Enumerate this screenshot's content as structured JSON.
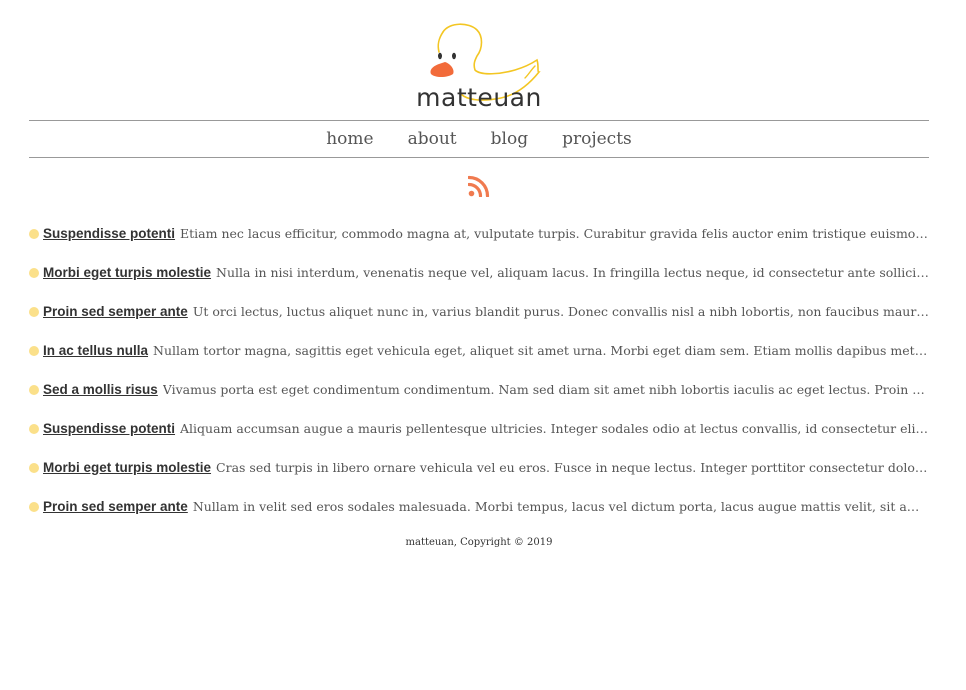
{
  "site": {
    "brand": "matteuan"
  },
  "nav": {
    "items": [
      "home",
      "about",
      "blog",
      "projects"
    ]
  },
  "feed": {
    "icon": "rss-icon",
    "accent": "#f07a4f"
  },
  "posts": [
    {
      "title": "Suspendisse potenti",
      "excerpt": "Etiam nec lacus efficitur, commodo magna at, vulputate turpis. Curabitur gravida felis auctor enim tristique euismod. Pelle..."
    },
    {
      "title": "Morbi eget turpis molestie",
      "excerpt": "Nulla in nisi interdum, venenatis neque vel, aliquam lacus. In fringilla lectus neque, id consectetur ante sollicitudin ..."
    },
    {
      "title": "Proin sed semper ante",
      "excerpt": "Ut orci lectus, luctus aliquet nunc in, varius blandit purus. Donec convallis nisl a nibh lobortis, non faucibus mauris ultri..."
    },
    {
      "title": "In ac tellus nulla",
      "excerpt": "Nullam tortor magna, sagittis eget vehicula eget, aliquet sit amet urna. Morbi eget diam sem. Etiam mollis dapibus metus non..."
    },
    {
      "title": "Sed a mollis risus",
      "excerpt": "Vivamus porta est eget condimentum condimentum. Nam sed diam sit amet nibh lobortis iaculis ac eget lectus. Proin facilis..."
    },
    {
      "title": "Suspendisse potenti",
      "excerpt": "Aliquam accumsan augue a mauris pellentesque ultricies. Integer sodales odio at lectus convallis, id consectetur elit pelle..."
    },
    {
      "title": "Morbi eget turpis molestie",
      "excerpt": "Cras sed turpis in libero ornare vehicula vel eu eros. Fusce in neque lectus. Integer porttitor consectetur dolor, quis c..."
    },
    {
      "title": "Proin sed semper ante",
      "excerpt": "Nullam in velit sed eros sodales malesuada. Morbi tempus, lacus vel dictum porta, lacus augue mattis velit, sit amet ultr..."
    }
  ],
  "footer": {
    "text": "matteuan, Copyright © 2019"
  },
  "colors": {
    "dot": "#fbe08a",
    "duck_outline": "#f3c623",
    "duck_beak": "#f26b3a",
    "rule": "#999999"
  }
}
